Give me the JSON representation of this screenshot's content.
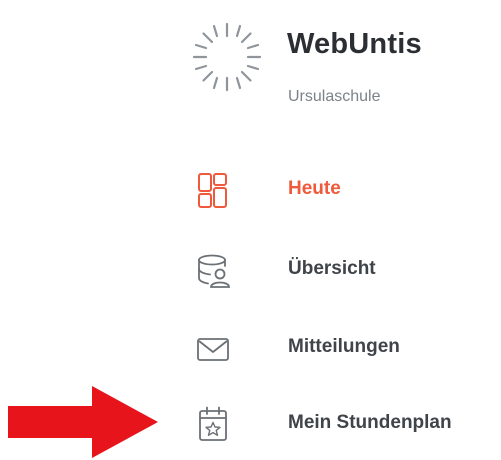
{
  "header": {
    "app_title": "WebUntis",
    "school": "Ursulaschule"
  },
  "nav": {
    "items": [
      {
        "label": "Heute",
        "icon": "today-grid-icon",
        "active": true
      },
      {
        "label": "Übersicht",
        "icon": "overview-icon",
        "active": false
      },
      {
        "label": "Mitteilungen",
        "icon": "mail-icon",
        "active": false
      },
      {
        "label": "Mein Stundenplan",
        "icon": "calendar-icon",
        "active": false
      }
    ]
  },
  "annotation": {
    "pointer": "red-arrow-icon",
    "points_to": "Mein Stundenplan"
  },
  "colors": {
    "accent": "#ee5a3b",
    "text": "#3f4449",
    "title": "#2b2f33",
    "muted": "#7d8288",
    "icon": "#6b7075",
    "arrow": "#e8141c"
  }
}
